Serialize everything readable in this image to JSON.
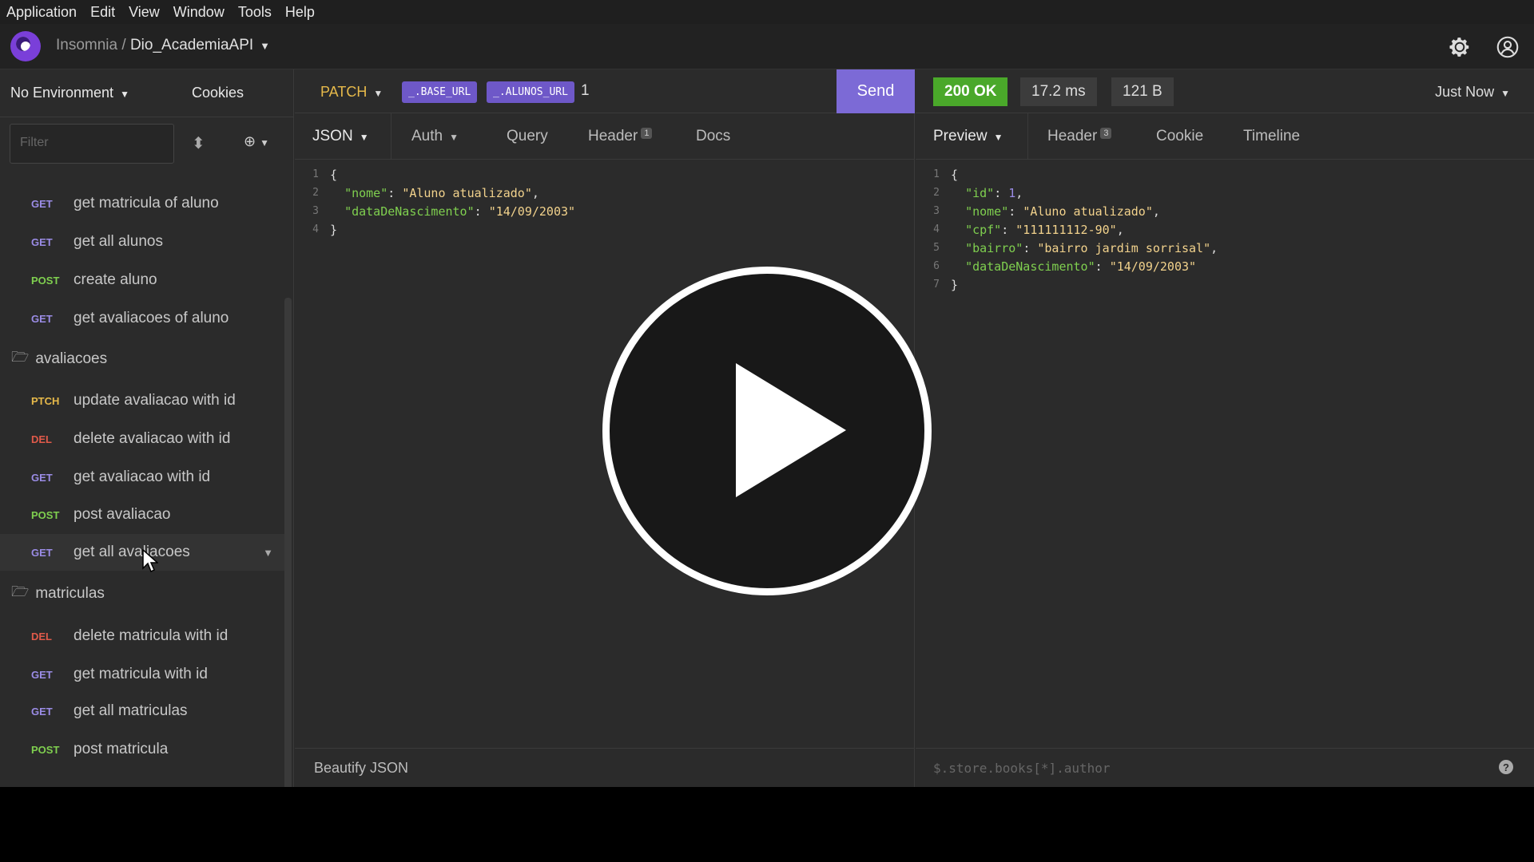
{
  "menu": [
    "Application",
    "Edit",
    "Window",
    "Tools",
    "Help"
  ],
  "menu_labels": {
    "app": "Application",
    "edit": "Edit",
    "view": "View",
    "window": "Window",
    "tools": "Tools",
    "help": "Help"
  },
  "header": {
    "app_name": "Insomnia",
    "separator": "/",
    "project": "Dio_AcademiaAPI"
  },
  "sidebar": {
    "environment": "No Environment",
    "cookies": "Cookies",
    "filter_placeholder": "Filter",
    "requests_top": [
      {
        "method": "GET",
        "name": "get matricula of aluno"
      },
      {
        "method": "GET",
        "name": "get all alunos"
      },
      {
        "method": "POST",
        "name": "create aluno"
      },
      {
        "method": "GET",
        "name": "get avaliacoes of aluno"
      }
    ],
    "folder_avaliacoes": "avaliacoes",
    "requests_avaliacoes": [
      {
        "method": "PTCH",
        "name": "update avaliacao with id"
      },
      {
        "method": "DEL",
        "name": "delete avaliacao with id"
      },
      {
        "method": "GET",
        "name": "get avaliacao with id"
      },
      {
        "method": "POST",
        "name": "post avaliacao"
      },
      {
        "method": "GET",
        "name": "get all avaliacoes"
      }
    ],
    "folder_matriculas": "matriculas",
    "requests_matriculas": [
      {
        "method": "DEL",
        "name": "delete matricula with id"
      },
      {
        "method": "GET",
        "name": "get matricula with id"
      },
      {
        "method": "GET",
        "name": "get all matriculas"
      },
      {
        "method": "POST",
        "name": "post matricula"
      }
    ]
  },
  "request": {
    "method": "PATCH",
    "url_tags": [
      "_.BASE_URL",
      "_.ALUNOS_URL"
    ],
    "url_suffix": "1",
    "send": "Send",
    "tabs": {
      "body": "JSON",
      "auth": "Auth",
      "query": "Query",
      "header": "Header",
      "header_count": "1",
      "docs": "Docs"
    },
    "body_lines": [
      {
        "n": "1",
        "t": "{"
      },
      {
        "n": "2",
        "key": "\"nome\"",
        "val": "\"Aluno atualizado\"",
        "end": ","
      },
      {
        "n": "3",
        "key": "\"dataDeNascimento\"",
        "val": "\"14/09/2003\"",
        "end": ""
      },
      {
        "n": "4",
        "t": "}"
      }
    ],
    "footer": "Beautify JSON"
  },
  "response": {
    "status": "200 OK",
    "time": "17.2 ms",
    "size": "121 B",
    "when": "Just Now",
    "tabs": {
      "preview": "Preview",
      "header": "Header",
      "header_count": "3",
      "cookie": "Cookie",
      "timeline": "Timeline"
    },
    "body_lines": [
      {
        "n": "1",
        "t": "{"
      },
      {
        "n": "2",
        "key": "\"id\"",
        "num": "1",
        "end": ","
      },
      {
        "n": "3",
        "key": "\"nome\"",
        "val": "\"Aluno atualizado\"",
        "end": ","
      },
      {
        "n": "4",
        "key": "\"cpf\"",
        "val": "\"111111112-90\"",
        "end": ","
      },
      {
        "n": "5",
        "key": "\"bairro\"",
        "val": "\"bairro jardim sorrisal\"",
        "end": ","
      },
      {
        "n": "6",
        "key": "\"dataDeNascimento\"",
        "val": "\"14/09/2003\"",
        "end": ""
      },
      {
        "n": "7",
        "t": "}"
      }
    ],
    "filter_placeholder": "$.store.books[*].author"
  },
  "colors": {
    "accent": "#7c6ad6",
    "ok": "#4aa82a",
    "get": "#9b8ce6",
    "post": "#7fcf4f",
    "patch": "#e6b94a",
    "delete": "#e05a4a"
  },
  "icons": {
    "settings": "gear-icon",
    "account": "user-icon",
    "play": "play-icon",
    "folder": "folder-icon"
  }
}
